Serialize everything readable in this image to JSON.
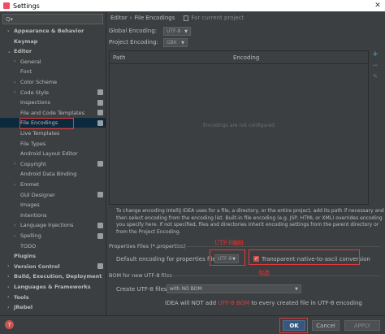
{
  "window": {
    "title": "Settings",
    "close_glyph": "✕"
  },
  "search": {
    "placeholder": "Q▾"
  },
  "sidebar": {
    "items": [
      {
        "label": "Appearance & Behavior",
        "arrow": "›",
        "bold": true
      },
      {
        "label": "Keymap",
        "bold": true
      },
      {
        "label": "Editor",
        "arrow": "⌄",
        "bold": true
      },
      {
        "label": "General",
        "arrow": "›"
      },
      {
        "label": "Font"
      },
      {
        "label": "Color Scheme",
        "arrow": "›"
      },
      {
        "label": "Code Style",
        "arrow": "›",
        "badge": true
      },
      {
        "label": "Inspections",
        "badge": true
      },
      {
        "label": "File and Code Templates",
        "badge": true
      },
      {
        "label": "File Encodings",
        "badge": true,
        "selected": true
      },
      {
        "label": "Live Templates"
      },
      {
        "label": "File Types"
      },
      {
        "label": "Android Layout Editor"
      },
      {
        "label": "Copyright",
        "arrow": "›",
        "badge": true
      },
      {
        "label": "Android Data Binding"
      },
      {
        "label": "Emmet",
        "arrow": "›"
      },
      {
        "label": "GUI Designer",
        "badge": true
      },
      {
        "label": "Images"
      },
      {
        "label": "Intentions"
      },
      {
        "label": "Language Injections",
        "arrow": "›",
        "badge": true
      },
      {
        "label": "Spelling",
        "arrow": "›",
        "badge": true
      },
      {
        "label": "TODO"
      },
      {
        "label": "Plugins",
        "bold": true
      },
      {
        "label": "Version Control",
        "arrow": "›",
        "bold": true,
        "badge": true
      },
      {
        "label": "Build, Execution, Deployment",
        "arrow": "›",
        "bold": true
      },
      {
        "label": "Languages & Frameworks",
        "arrow": "›",
        "bold": true
      },
      {
        "label": "Tools",
        "arrow": "›",
        "bold": true
      },
      {
        "label": "JRebel",
        "arrow": "›",
        "bold": true
      }
    ]
  },
  "breadcrumb": {
    "parent": "Editor",
    "sep": "›",
    "current": "File Encodings",
    "scope": "For current project"
  },
  "global_encoding": {
    "label": "Global Encoding:",
    "value": "UTF-8"
  },
  "project_encoding": {
    "label": "Project Encoding:",
    "value": "GBK"
  },
  "table": {
    "col_path": "Path",
    "col_encoding": "Encoding",
    "empty": "Encodings are not configured",
    "add": "+",
    "remove": "−",
    "edit": "✎"
  },
  "info_text": "To change encoding IntelliJ IDEA uses for a file, a directory, or the entire project, add its path if necessary and then select encoding from the encoding list. Built-in file encoding (e.g. JSP, HTML or XML) overrides encoding you specify here. If not specified, files and directories inherit encoding settings from the parent directory or from the Project Encoding.",
  "properties": {
    "section": "Properties Files (*.properties)",
    "default_label": "Default encoding for properties files:",
    "default_value": "UTF-8",
    "native_label": "Transparent native-to-ascii conversion",
    "native_checked": "✓"
  },
  "bom": {
    "section": "BOM for new UTF-8 files",
    "create_label": "Create UTF-8 files:",
    "create_value": "with NO BOM",
    "note_pre": "IDEA will NOT add",
    "note_link": "UTF-8 BOM",
    "note_post": "to every created file in UTF-8 encoding"
  },
  "annotations": {
    "utf8_note": "UTF-8编码",
    "check_note": "勾选"
  },
  "buttons": {
    "ok": "OK",
    "cancel": "Cancel",
    "apply": "APPLY",
    "help": "?"
  },
  "colors": {
    "bg": "#3c3f41",
    "selected": "#0d293e",
    "accent_red": "#e03a3a",
    "primary": "#365880"
  }
}
